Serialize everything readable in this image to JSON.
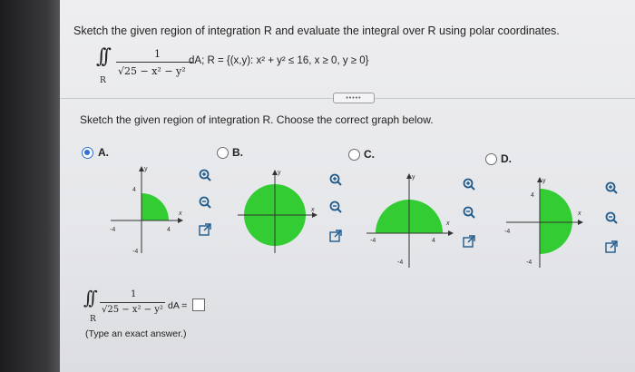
{
  "question": {
    "instruction": "Sketch the given region of integration R and evaluate the integral over R using polar coordinates.",
    "integrand_numerator": "1",
    "integrand_denominator": "√25 − x² − y²",
    "region_label": "R",
    "region_def": "dA; R = {(x,y): x² + y² ≤ 16, x ≥ 0, y ≥ 0}"
  },
  "more_button": "•••••",
  "subquestion": "Sketch the given region of integration R. Choose the correct graph below.",
  "options": [
    {
      "label": "A.",
      "selected": true
    },
    {
      "label": "B.",
      "selected": false
    },
    {
      "label": "C.",
      "selected": false
    },
    {
      "label": "D.",
      "selected": false
    }
  ],
  "graph_labels": {
    "y": "y",
    "x": "x",
    "pos4": "4",
    "neg4": "-4"
  },
  "answer": {
    "numerator": "1",
    "denominator": "√25 − x² − y²",
    "region": "R",
    "suffix": "dA =",
    "hint": "(Type an exact answer.)"
  },
  "colors": {
    "region_fill": "#33cc33",
    "selected_radio": "#2f6fd6",
    "icon": "#1f5a8c"
  },
  "icons": [
    "zoom-in-icon",
    "zoom-out-icon",
    "popout-icon"
  ]
}
